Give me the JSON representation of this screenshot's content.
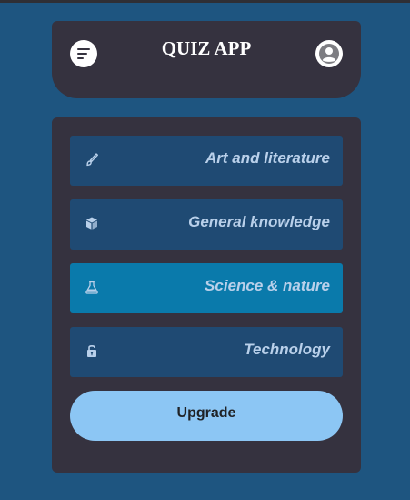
{
  "header": {
    "title": "QUIZ APP",
    "menu_icon": "menu-icon",
    "profile_icon": "user-avatar-icon"
  },
  "categories": [
    {
      "label": "Art and literature",
      "icon": "paintbrush-icon",
      "active": false
    },
    {
      "label": "General knowledge",
      "icon": "cube-icon",
      "active": false
    },
    {
      "label": "Science & nature",
      "icon": "flask-icon",
      "active": true
    },
    {
      "label": "Technology",
      "icon": "unlock-icon",
      "active": false
    }
  ],
  "upgrade_label": "Upgrade",
  "colors": {
    "background": "#1e5580",
    "card": "#35323f",
    "category": "#1f4a73",
    "category_active": "#0a7aab",
    "category_text": "#b9d0ea",
    "upgrade": "#8cc6f4"
  }
}
